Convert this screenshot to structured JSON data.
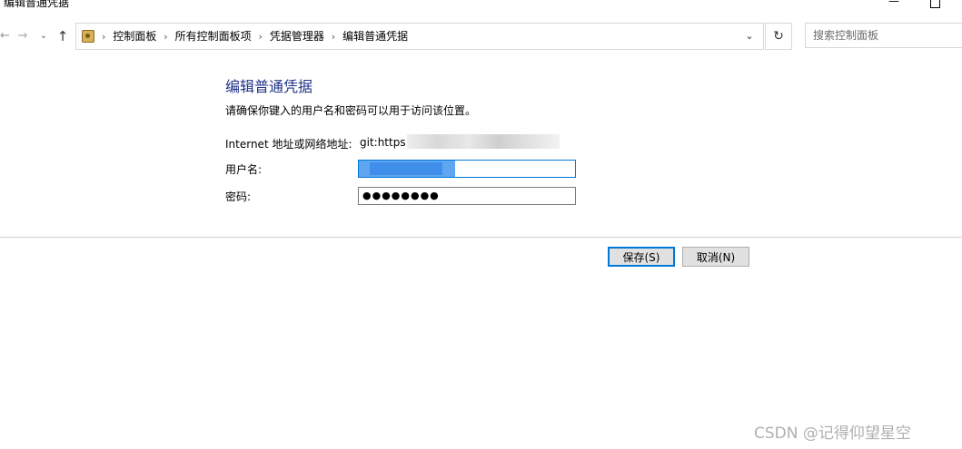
{
  "window": {
    "title": "编辑普通凭据",
    "minimize_glyph": "—"
  },
  "nav": {
    "back_icon": "←",
    "forward_icon": "→",
    "recent_icon": "⌄",
    "up_icon": "↑",
    "breadcrumbs": [
      "控制面板",
      "所有控制面板项",
      "凭据管理器",
      "编辑普通凭据"
    ],
    "separator": "›",
    "dropdown_icon": "⌄",
    "refresh_icon": "↻"
  },
  "search": {
    "placeholder": "搜索控制面板"
  },
  "form": {
    "heading": "编辑普通凭据",
    "description": "请确保你键入的用户名和密码可以用于访问该位置。",
    "url_label": "Internet 地址或网络地址:",
    "url_value": "git:https",
    "username_label": "用户名:",
    "password_label": "密码:",
    "password_mask": "●●●●●●●●"
  },
  "buttons": {
    "save": "保存(S)",
    "cancel": "取消(N)"
  },
  "watermark": "CSDN @记得仰望星空",
  "colors": {
    "heading": "#1e3287",
    "focus_border": "#0078d7"
  }
}
